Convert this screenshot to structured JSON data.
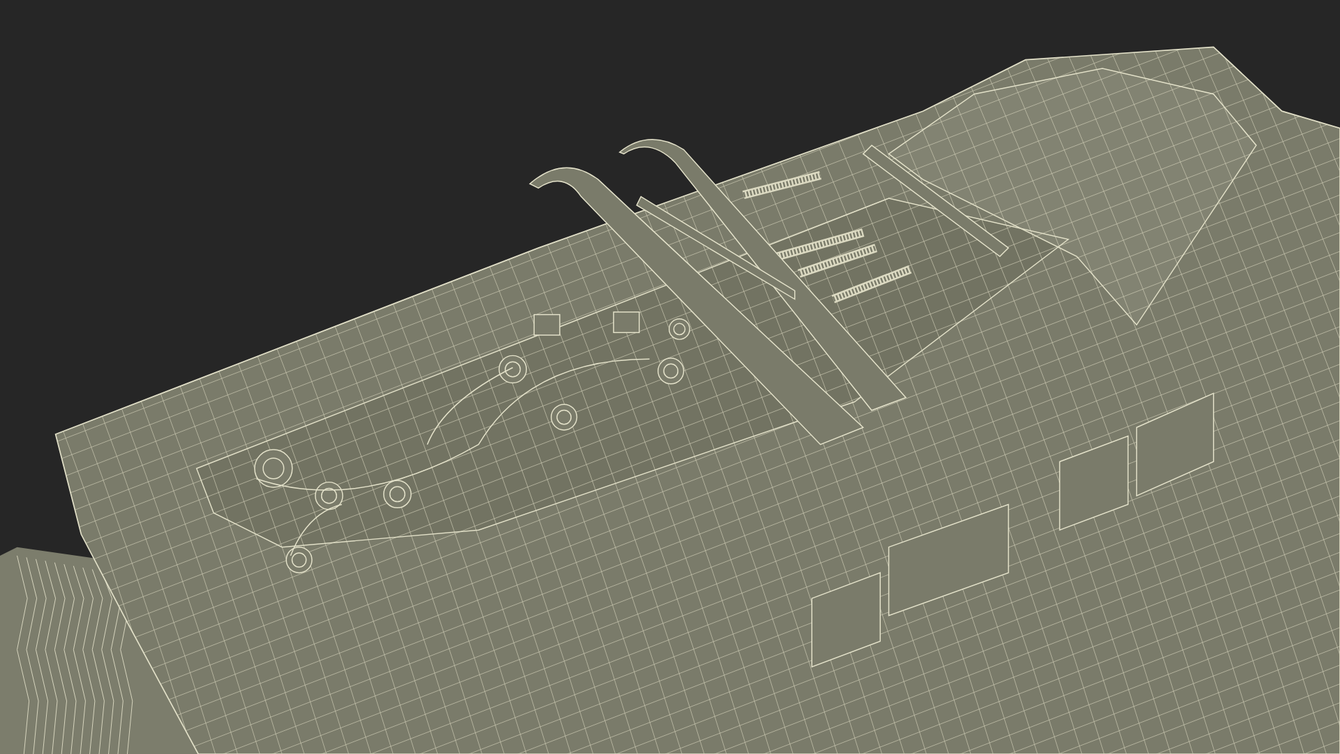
{
  "scene": {
    "kind": "wireframe"
  }
}
